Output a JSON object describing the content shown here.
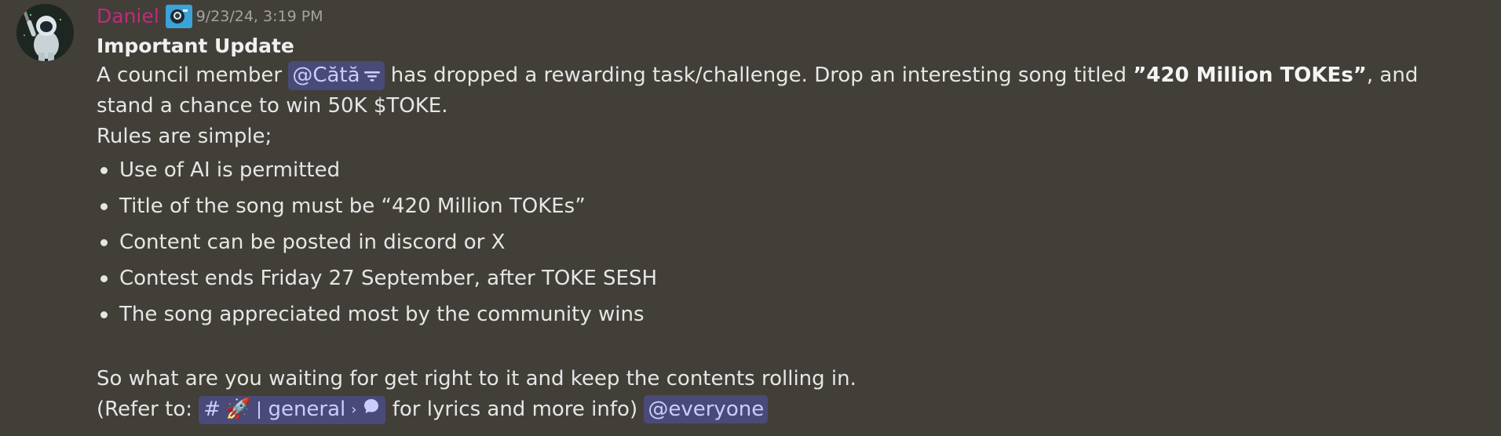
{
  "message": {
    "author": "Daniel",
    "role_badge": "astronaut-badge-icon",
    "timestamp": "9/23/24, 3:19 PM",
    "title": "Important Update",
    "intro_before": "A council member ",
    "mention_user": "@Cătă",
    "intro_middle": " has dropped a rewarding task/challenge. Drop an interesting song titled ",
    "song_title": "”420 Million TOKEs”",
    "intro_after": ", and stand a chance to win 50K $TOKE.",
    "rules_heading": "Rules are simple;",
    "rules": [
      "Use of AI is permitted",
      "Title of the song must be “420 Million TOKEs”",
      "Content can be posted in discord or X",
      "Contest ends Friday 27 September, after TOKE SESH",
      "The song appreciated most by the community wins"
    ],
    "closing": "So what are you waiting for get right to it and keep the contents rolling in.",
    "refer_before": "(Refer to: ",
    "channel_hash": "#",
    "channel_emoji": "🚀",
    "channel_name": "general",
    "channel_chevron": "›",
    "refer_after": " for lyrics and more info) ",
    "everyone_mention": "@everyone"
  },
  "colors": {
    "background": "#413f38",
    "username": "#c02a7c",
    "mention_bg": "#4a4a78",
    "mention_text": "#c9cdfb"
  }
}
